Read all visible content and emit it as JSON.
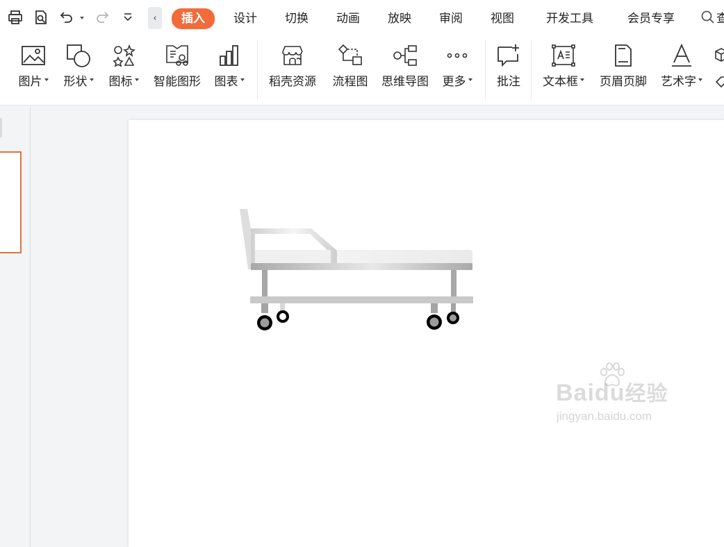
{
  "menubar": {
    "tabs": [
      "插入",
      "设计",
      "切换",
      "动画",
      "放映",
      "审阅",
      "视图",
      "开发工具",
      "会员专享"
    ],
    "active_tab": "插入",
    "search_label": "查找"
  },
  "ribbon": {
    "tools": [
      {
        "label": "图片",
        "icon": "image-icon",
        "dropdown": true
      },
      {
        "label": "形状",
        "icon": "shapes-icon",
        "dropdown": true
      },
      {
        "label": "图标",
        "icon": "icon-library-icon",
        "dropdown": true
      },
      {
        "label": "智能图形",
        "icon": "smart-art-icon",
        "dropdown": false
      },
      {
        "label": "图表",
        "icon": "bar-chart-icon",
        "dropdown": true
      },
      {
        "label": "稻壳资源",
        "icon": "store-icon",
        "dropdown": false
      },
      {
        "label": "流程图",
        "icon": "flowchart-icon",
        "dropdown": false
      },
      {
        "label": "思维导图",
        "icon": "mindmap-icon",
        "dropdown": false
      },
      {
        "label": "更多",
        "icon": "more-icon",
        "dropdown": true
      },
      {
        "label": "批注",
        "icon": "comment-icon",
        "dropdown": false
      },
      {
        "label": "文本框",
        "icon": "textbox-icon",
        "dropdown": true
      },
      {
        "label": "页眉页脚",
        "icon": "header-footer-icon",
        "dropdown": false
      },
      {
        "label": "艺术字",
        "icon": "wordart-icon",
        "dropdown": true
      }
    ]
  },
  "watermark": {
    "brand": "Bai",
    "brand2": "du",
    "brand_cn": "经验",
    "url": "jingyan.baidu.com"
  },
  "colors": {
    "accent": "#f26c3b",
    "thumb_border": "#e2723d"
  }
}
